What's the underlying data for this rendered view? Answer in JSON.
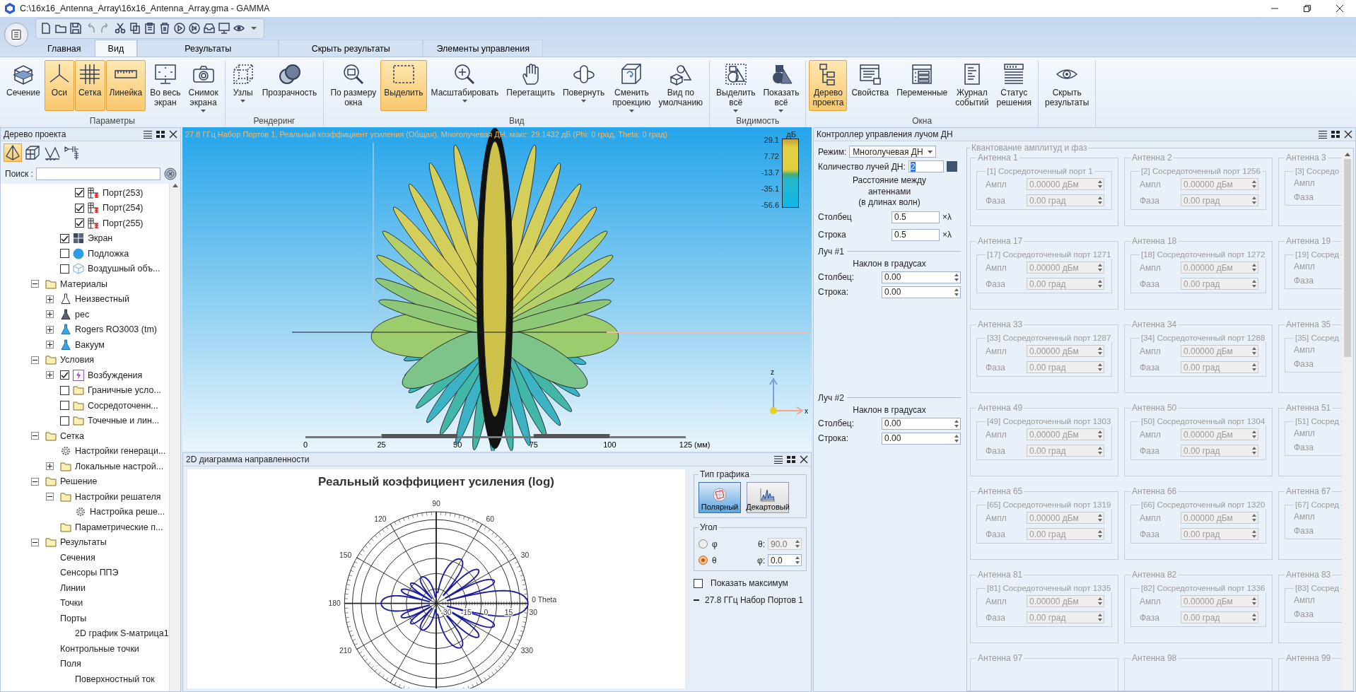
{
  "window": {
    "title": "C:\\16x16_Antenna_Array\\16x16_Antenna_Array.gma - GAMMA"
  },
  "quick_access": [
    {
      "disabled": false
    },
    {
      "disabled": false
    },
    {
      "disabled": false
    },
    {
      "disabled": true
    },
    {
      "disabled": true
    },
    {
      "disabled": false
    },
    {
      "disabled": false
    },
    {
      "disabled": false
    },
    {
      "disabled": false
    },
    {
      "disabled": false
    },
    {
      "disabled": false
    },
    {
      "disabled": false
    },
    {
      "disabled": false
    },
    {
      "disabled": false
    },
    {
      "disabled": false
    }
  ],
  "ribbon": {
    "tabs": [
      {
        "label": "Главная",
        "selected": false,
        "kind": "normal"
      },
      {
        "label": "Вид",
        "selected": true,
        "kind": "normal"
      },
      {
        "label": "Результаты",
        "selected": false,
        "kind": "contextual"
      },
      {
        "label": "Скрыть результаты",
        "selected": false,
        "kind": "contextual"
      },
      {
        "label": "Элементы управления",
        "selected": false,
        "kind": "contextual"
      }
    ],
    "groups": [
      {
        "label": "Параметры",
        "buttons": [
          {
            "label": "Сечение",
            "selected": false
          },
          {
            "label": "Оси",
            "selected": true
          },
          {
            "label": "Сетка",
            "selected": true
          },
          {
            "label": "Линейка",
            "selected": true
          },
          {
            "label": "Во весь\nэкран",
            "selected": false
          },
          {
            "label": "Снимок\nэкрана",
            "selected": false,
            "dropdown": true
          }
        ]
      },
      {
        "label": "Рендеринг",
        "buttons": [
          {
            "label": "Узлы",
            "selected": false,
            "dropdown": true
          },
          {
            "label": "Прозрачность",
            "selected": false
          }
        ]
      },
      {
        "label": "Вид",
        "buttons": [
          {
            "label": "По размеру\nокна",
            "selected": false
          },
          {
            "label": "Выделить",
            "selected": true
          },
          {
            "label": "Масштабировать",
            "selected": false,
            "dropdown": true
          },
          {
            "label": "Перетащить",
            "selected": false
          },
          {
            "label": "Повернуть",
            "selected": false,
            "dropdown": true
          },
          {
            "label": "Сменить\nпроекцию",
            "selected": false,
            "dropdown": true
          },
          {
            "label": "Вид по\nумолчанию",
            "selected": false
          }
        ]
      },
      {
        "label": "Видимость",
        "buttons": [
          {
            "label": "Выделить\nвсё",
            "selected": false,
            "dropdown": true
          },
          {
            "label": "Показать\nвсё",
            "selected": false,
            "dropdown": true
          }
        ]
      },
      {
        "label": "Окна",
        "buttons": [
          {
            "label": "Дерево\nпроекта",
            "selected": true
          },
          {
            "label": "Свойства",
            "selected": false
          },
          {
            "label": "Переменные",
            "selected": false
          },
          {
            "label": "Журнал\nсобытий",
            "selected": false
          },
          {
            "label": "Статус\nрешения",
            "selected": false
          }
        ]
      },
      {
        "buttons": [
          {
            "label": "Скрыть\nрезультаты",
            "selected": false
          }
        ]
      }
    ]
  },
  "project_tree": {
    "title": "Дерево проекта",
    "tools": [
      {
        "selected": true
      },
      {
        "selected": false
      },
      {
        "selected": false
      },
      {
        "selected": false
      }
    ],
    "search_label": "Поиск :",
    "items": [
      {
        "children": [
          {
            "children": [
              {
                "kind": "port",
                "label": "Порт(253)",
                "checked": true
              },
              {
                "kind": "port",
                "label": "Порт(254)",
                "checked": true
              },
              {
                "kind": "port",
                "label": "Порт(255)",
                "checked": true
              }
            ]
          },
          {
            "kind": "screen",
            "label": "Экран",
            "checked": true
          },
          {
            "kind": "substrate",
            "label": "Подложка",
            "checked": false
          },
          {
            "kind": "airbox",
            "label": "Воздушный объ...",
            "checked": false
          }
        ]
      },
      {
        "kind": "folder",
        "label": "Материалы",
        "expanded": true,
        "children": [
          {
            "kind": "material",
            "label": "Неизвестный",
            "expanded": false
          },
          {
            "kind": "material-dark",
            "label": "рес",
            "expanded": false
          },
          {
            "kind": "dielectric",
            "label": "Rogers RO3003 (tm)",
            "expanded": false
          },
          {
            "kind": "dielectric",
            "label": "Вакуум",
            "expanded": false
          }
        ]
      },
      {
        "kind": "folder",
        "label": "Условия",
        "expanded": true,
        "children": [
          {
            "kind": "excitation",
            "label": "Возбуждения",
            "expanded": false,
            "checked": true
          },
          {
            "kind": "folder",
            "label": "Граничные усло...",
            "checked": false
          },
          {
            "kind": "folder",
            "label": "Сосредоточенн...",
            "checked": false
          },
          {
            "kind": "folder",
            "label": "Точечные и лин...",
            "checked": false
          }
        ]
      },
      {
        "kind": "folder",
        "label": "Сетка",
        "expanded": true,
        "children": [
          {
            "kind": "settings",
            "label": "Настройки генераци..."
          },
          {
            "kind": "folder",
            "label": "Локальные настрой...",
            "expanded": false
          }
        ]
      },
      {
        "kind": "folder",
        "label": "Решение",
        "expanded": true,
        "children": [
          {
            "kind": "folder",
            "label": "Настройки решателя",
            "expanded": true,
            "children": [
              {
                "kind": "settings",
                "label": "Настройка реше..."
              }
            ]
          },
          {
            "kind": "folder",
            "label": "Параметрические п..."
          }
        ]
      },
      {
        "kind": "folder",
        "label": "Результаты",
        "expanded": true,
        "children": [
          {
            "kind": "result",
            "label": "Сечения"
          },
          {
            "kind": "result",
            "label": "Сенсоры ППЭ"
          },
          {
            "kind": "result",
            "label": "Линии"
          },
          {
            "kind": "result",
            "label": "Точки"
          },
          {
            "kind": "result",
            "label": "Порты",
            "children": [
              {
                "kind": "result",
                "label": "2D график S-матрица1"
              }
            ]
          },
          {
            "kind": "result",
            "label": "Контрольные точки"
          },
          {
            "kind": "result",
            "label": "Поля",
            "children": [
              {
                "kind": "result",
                "label": "Поверхностный ток"
              }
            ]
          }
        ]
      }
    ]
  },
  "view3d": {
    "caption": "27.8 ГГц Набор Портов 1, Реальный коэффициент усиления (Общая), Многолучевая ДН, макс: 29.1432 дБ (Phi: 0 град, Theta: 0 град)",
    "legend": {
      "unit": "дБ",
      "ticks": [
        "29.1",
        "7.72",
        "-13.7",
        "-35.1",
        "-56.6"
      ]
    },
    "ruler": {
      "ticks": [
        "0",
        "25",
        "50",
        "75",
        "100",
        "125"
      ],
      "unit": "(мм)"
    },
    "axes": {
      "vertical": "z",
      "horizontal": "x"
    }
  },
  "pattern2d": {
    "title": "2D диаграмма направленности",
    "plot": {
      "title": "Реальный коэффициент усиления (log)",
      "angle_labels": [
        "90",
        "60",
        "30",
        "0 Theta",
        "330",
        "210",
        "180",
        "150",
        "120"
      ],
      "radius_labels": [
        "-30",
        "-15",
        "0",
        "15",
        "30"
      ]
    },
    "plot_type": {
      "title": "Тип графика",
      "options": [
        {
          "label": "Полярный",
          "selected": true
        },
        {
          "label": "Декартовый",
          "selected": false
        }
      ]
    },
    "angle": {
      "title": "Угол",
      "options": [
        {
          "label": "φ",
          "selected": false
        },
        {
          "label": "θ",
          "selected": true
        }
      ],
      "fields": [
        {
          "label": "θ:",
          "value": "90.0",
          "disabled": true
        },
        {
          "label": "φ:",
          "value": "0.0",
          "disabled": false
        }
      ]
    },
    "show_max": {
      "label": "Показать максимум",
      "checked": false
    },
    "legend": [
      "27.8 ГГц Набор Портов 1"
    ]
  },
  "beam_controller": {
    "title": "Контроллер управления лучом ДН",
    "mode_label": "Режим:",
    "mode": "Многолучевая ДН",
    "count_label": "Количество лучей ДН:",
    "count": "2",
    "count_selected": true,
    "spacing_title": "Расстояние между\nантеннами\n(в длинах волн)",
    "spacing": [
      {
        "label": "Столбец",
        "value": "0.5",
        "unit": "×λ"
      },
      {
        "label": "Строка",
        "value": "0.5",
        "unit": "×λ"
      }
    ],
    "beams": [
      {
        "title": "Луч #1",
        "subtitle": "Наклон в градусах",
        "fields": [
          {
            "label": "Столбец:",
            "value": "0.00"
          },
          {
            "label": "Строка:",
            "value": "0.00"
          }
        ]
      },
      {
        "title": "Луч #2",
        "subtitle": "Наклон в градусах",
        "fields": [
          {
            "label": "Столбец:",
            "value": "0.00"
          },
          {
            "label": "Строка:",
            "value": "0.00"
          }
        ]
      }
    ],
    "quantization": {
      "title": "Квантование амплитуд и фаз",
      "disabled": true,
      "rows": [
        {
          "antennas": [
            {
              "title": "Антенна 1",
              "port": "[1] Сосредоточенный порт 1",
              "amp_label": "Ампл",
              "amp": "0.00000 дБм",
              "phase_label": "Фаза",
              "phase": "0.00 град"
            },
            {
              "title": "Антенна 2",
              "port": "[2] Сосредоточенный порт 1256",
              "amp_label": "Ампл",
              "amp": "0.00000 дБм",
              "phase_label": "Фаза",
              "phase": "0.00 град"
            },
            {
              "title": "Антенна 3",
              "port": "[3] Сосредо",
              "amp_label": "Ампл",
              "phase_label": "Фаза"
            }
          ]
        },
        {
          "antennas": [
            {
              "title": "Антенна 17",
              "port": "[17] Сосредоточенный порт 1271",
              "amp_label": "Ампл",
              "amp": "0.00000 дБм",
              "phase_label": "Фаза",
              "phase": "0.00 град"
            },
            {
              "title": "Антенна 18",
              "port": "[18] Сосредоточенный порт 1272",
              "amp_label": "Ампл",
              "amp": "0.00000 дБм",
              "phase_label": "Фаза",
              "phase": "0.00 град"
            },
            {
              "title": "Антенна 19",
              "port": "[19] Сосред",
              "amp_label": "Ампл",
              "phase_label": "Фаза"
            }
          ]
        },
        {
          "antennas": [
            {
              "title": "Антенна 33",
              "port": "[33] Сосредоточенный порт 1287",
              "amp_label": "Ампл",
              "amp": "0.00000 дБм",
              "phase_label": "Фаза",
              "phase": "0.00 град"
            },
            {
              "title": "Антенна 34",
              "port": "[34] Сосредоточенный порт 1288",
              "amp_label": "Ампл",
              "amp": "0.00000 дБм",
              "phase_label": "Фаза",
              "phase": "0.00 град"
            },
            {
              "title": "Антенна 35",
              "port": "[35] Сосред",
              "amp_label": "Ампл",
              "phase_label": "Фаза"
            }
          ]
        },
        {
          "antennas": [
            {
              "title": "Антенна 49",
              "port": "[49] Сосредоточенный порт 1303",
              "amp_label": "Ампл",
              "amp": "0.00000 дБм",
              "phase_label": "Фаза",
              "phase": "0.00 град"
            },
            {
              "title": "Антенна 50",
              "port": "[50] Сосредоточенный порт 1304",
              "amp_label": "Ампл",
              "amp": "0.00000 дБм",
              "phase_label": "Фаза",
              "phase": "0.00 град"
            },
            {
              "title": "Антенна 51",
              "port": "[51] Сосред",
              "amp_label": "Ампл",
              "phase_label": "Фаза"
            }
          ]
        },
        {
          "antennas": [
            {
              "title": "Антенна 65",
              "port": "[65] Сосредоточенный порт 1319",
              "amp_label": "Ампл",
              "amp": "0.00000 дБм",
              "phase_label": "Фаза",
              "phase": "0.00 град"
            },
            {
              "title": "Антенна 66",
              "port": "[66] Сосредоточенный порт 1320",
              "amp_label": "Ампл",
              "amp": "0.00000 дБм",
              "phase_label": "Фаза",
              "phase": "0.00 град"
            },
            {
              "title": "Антенна 67",
              "port": "[67] Сосред",
              "amp_label": "Ампл",
              "phase_label": "Фаза"
            }
          ]
        },
        {
          "antennas": [
            {
              "title": "Антенна 81",
              "port": "[81] Сосредоточенный порт 1335",
              "amp_label": "Ампл",
              "amp": "0.00000 дБм",
              "phase_label": "Фаза",
              "phase": "0.00 град"
            },
            {
              "title": "Антенна 82",
              "port": "[82] Сосредоточенный порт 1336",
              "amp_label": "Ампл",
              "amp": "0.00000 дБм",
              "phase_label": "Фаза",
              "phase": "0.00 град"
            },
            {
              "title": "Антенна 83",
              "port": "[83] Сосред",
              "amp_label": "Ампл",
              "phase_label": "Фаза"
            }
          ]
        },
        {
          "antennas": [
            {
              "title": "Антенна 97"
            },
            {
              "title": "Антенна 98"
            },
            {
              "title": "Антенна 99"
            }
          ]
        }
      ]
    }
  }
}
